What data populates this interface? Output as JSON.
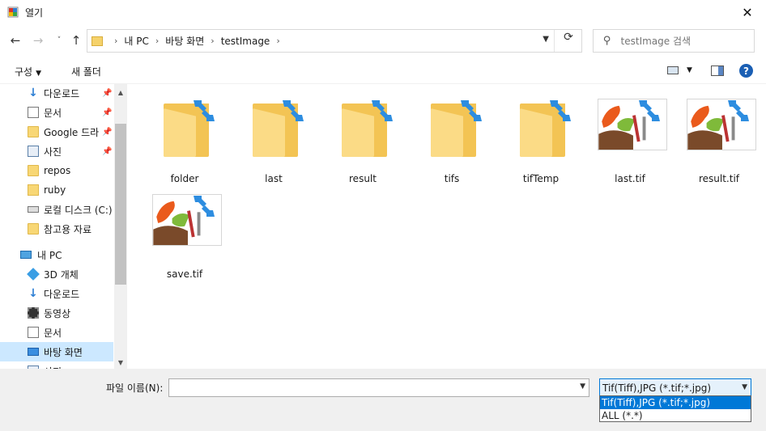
{
  "window": {
    "title": "열기"
  },
  "nav": {
    "back": "←",
    "forward": "→",
    "recent": "˅",
    "up": "↑"
  },
  "address": {
    "crumbs": [
      "내 PC",
      "바탕 화면",
      "testImage"
    ],
    "separator": "›"
  },
  "search": {
    "placeholder": "testImage 검색"
  },
  "toolbar": {
    "organize": "구성",
    "new_folder": "새 폴더"
  },
  "sidebar": {
    "items": [
      {
        "label": "다운로드",
        "icon": "download-icon",
        "pinned": true
      },
      {
        "label": "문서",
        "icon": "document-icon",
        "pinned": true
      },
      {
        "label": "Google 드라이브",
        "icon": "folder-icon",
        "pinned": true
      },
      {
        "label": "사진",
        "icon": "pictures-icon",
        "pinned": true
      },
      {
        "label": "repos",
        "icon": "folder-icon",
        "pinned": false
      },
      {
        "label": "ruby",
        "icon": "folder-icon",
        "pinned": false
      },
      {
        "label": "로컬 디스크 (C:)",
        "icon": "drive-icon",
        "pinned": false
      },
      {
        "label": "참고용 자료",
        "icon": "folder-icon",
        "pinned": false
      },
      {
        "label": "내 PC",
        "icon": "pc-icon",
        "pinned": false
      },
      {
        "label": "3D 개체",
        "icon": "3d-objects-icon",
        "pinned": false
      },
      {
        "label": "다운로드",
        "icon": "download-icon",
        "pinned": false
      },
      {
        "label": "동영상",
        "icon": "video-icon",
        "pinned": false
      },
      {
        "label": "문서",
        "icon": "document-icon",
        "pinned": false
      },
      {
        "label": "바탕 화면",
        "icon": "desktop-icon",
        "pinned": false,
        "selected": true
      },
      {
        "label": "사진",
        "icon": "pictures-icon",
        "pinned": false
      }
    ]
  },
  "files": [
    {
      "name": "folder",
      "kind": "folder"
    },
    {
      "name": "last",
      "kind": "folder"
    },
    {
      "name": "result",
      "kind": "folder"
    },
    {
      "name": "tifs",
      "kind": "folder"
    },
    {
      "name": "tifTemp",
      "kind": "folder"
    },
    {
      "name": "last.tif",
      "kind": "image"
    },
    {
      "name": "result.tif",
      "kind": "image"
    },
    {
      "name": "save.tif",
      "kind": "image"
    }
  ],
  "bottom": {
    "filename_label": "파일 이름(N):",
    "filename_value": "",
    "filetype_selected": "Tif(Tiff),JPG (*.tif;*.jpg)",
    "filetype_options": [
      "Tif(Tiff),JPG (*.tif;*.jpg)",
      "ALL (*.*)"
    ]
  },
  "colors": {
    "accent": "#0078d7",
    "selection": "#cce8ff",
    "folder": "#f8d775"
  }
}
